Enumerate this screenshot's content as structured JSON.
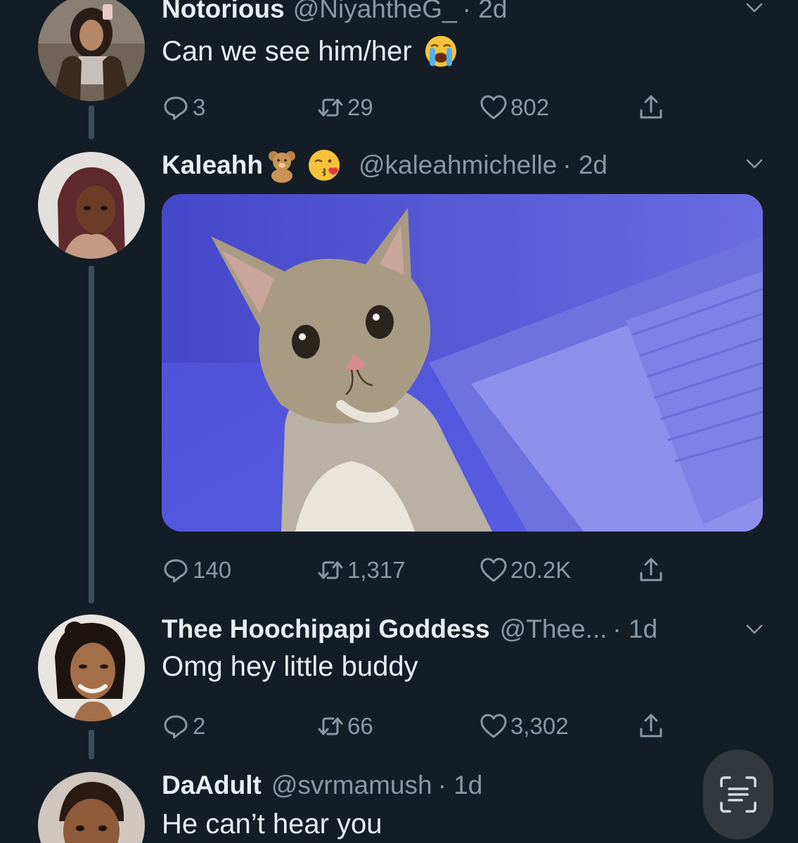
{
  "tweets": [
    {
      "name": "Notorious",
      "handle": "@NiyahtheG_",
      "time": "· 2d",
      "text": "Can we see him/her",
      "replies": "3",
      "retweets": "29",
      "likes": "802"
    },
    {
      "name": "Kaleahh",
      "handle": "@kaleahmichelle",
      "time": "· 2d",
      "text": "",
      "replies": "140",
      "retweets": "1,317",
      "likes": "20.2K"
    },
    {
      "name": "Thee Hoochipapi Goddess",
      "handle": "@Thee...",
      "time": "· 1d",
      "text": "Omg hey little buddy",
      "replies": "2",
      "retweets": "66",
      "likes": "3,302"
    },
    {
      "name": "DaAdult",
      "handle": "@svrmamush",
      "time": "· 1d",
      "text": "He can’t hear you"
    }
  ],
  "icons": {
    "reply": "reply-icon",
    "retweet": "retweet-icon",
    "like": "heart-icon",
    "share": "share-icon",
    "more": "chevron-down-icon",
    "scan": "scan-text-icon"
  },
  "colors": {
    "background": "#141d26",
    "primary_text": "#e9eef2",
    "secondary_text": "#8b98a5",
    "thread_line": "#3d4c5a"
  }
}
